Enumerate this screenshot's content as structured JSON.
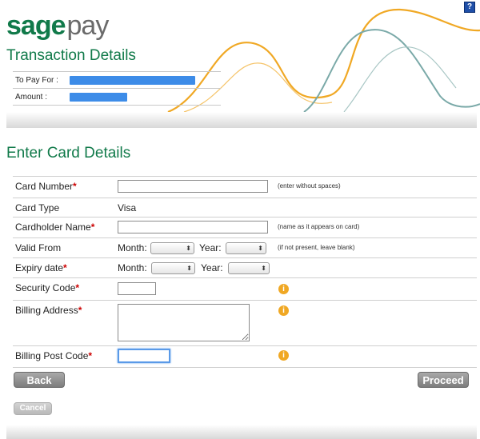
{
  "header": {
    "logo_sage": "sage",
    "logo_pay": "pay",
    "help_label": "?"
  },
  "transaction": {
    "title": "Transaction Details",
    "to_pay_for_label": "To Pay For :",
    "amount_label": "Amount :"
  },
  "card": {
    "title": "Enter Card Details",
    "card_number_label": "Card Number",
    "card_number_hint": "(enter without spaces)",
    "card_type_label": "Card Type",
    "card_type_value": "Visa",
    "cardholder_label": "Cardholder Name",
    "cardholder_hint": "(name as it appears on card)",
    "valid_from_label": "Valid From",
    "valid_from_hint": "(if not present, leave blank)",
    "expiry_label": "Expiry date",
    "month_label": "Month:",
    "year_label": "Year:",
    "security_label": "Security Code",
    "billing_address_label": "Billing Address",
    "billing_post_label": "Billing Post Code",
    "required_marker": "*",
    "info_icon_glyph": "i"
  },
  "buttons": {
    "back": "Back",
    "proceed": "Proceed",
    "cancel": "Cancel"
  },
  "colors": {
    "brand_green": "#117a4a",
    "redaction_blue": "#3d8ce8",
    "info_orange": "#f0a824"
  }
}
